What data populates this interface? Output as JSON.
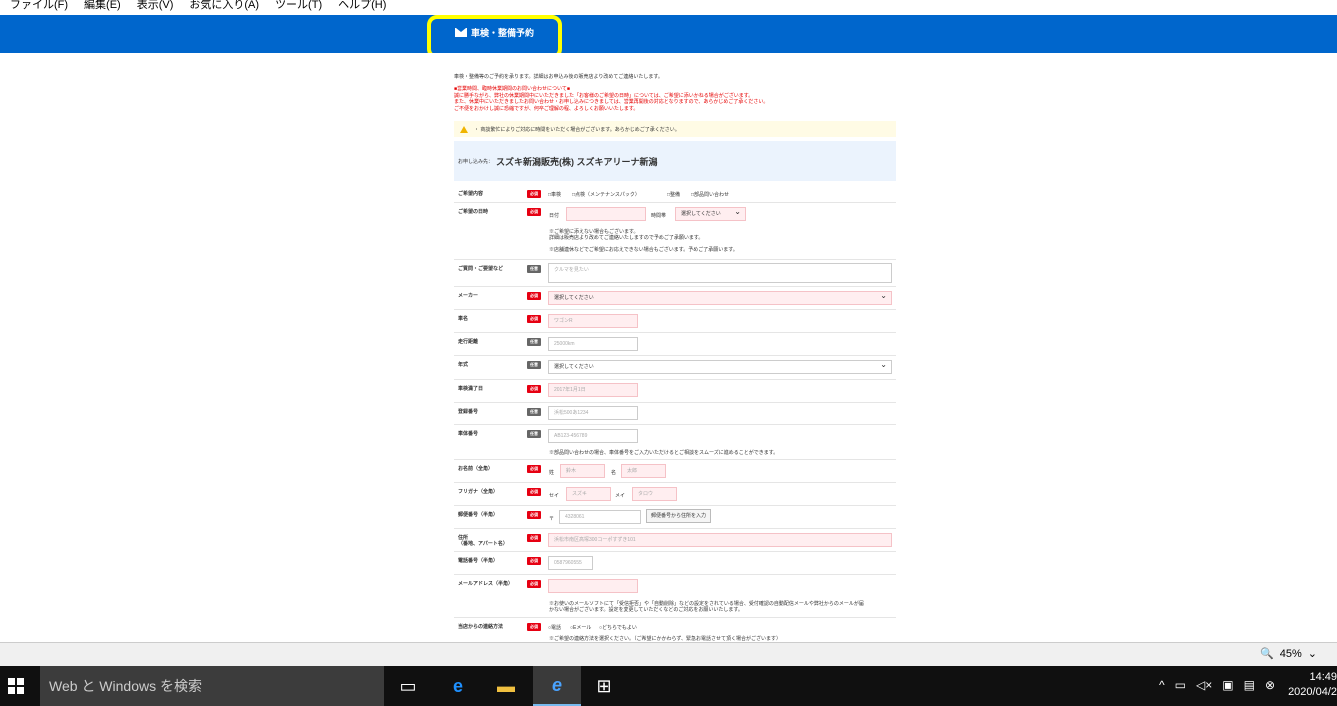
{
  "menu": [
    "ファイル(F)",
    "編集(E)",
    "表示(V)",
    "お気に入り(A)",
    "ツール(T)",
    "ヘルプ(H)"
  ],
  "header": {
    "title": "車検・整備予約"
  },
  "intro": "車検・整備等のご予約を承ります。詳細はお申込み後の販売店より改めてご連絡いたします。",
  "notice": [
    "■営業時間、臨時休業期間のお問い合わせについて■",
    "誠に勝手ながら、弊社の休業期間中にいただきました「お客様のご希望の日時」については、ご希望に添いかねる場合がございます。",
    "また、休業中にいただきましたお問い合わせ・お申し込みにつきましては、営業再開後の対応となりますので、あらかじめご了承ください。",
    "ご不便をおかけし誠に恐縮ですが、何卒ご理解の程、よろしくお願いいたします。"
  ],
  "warning": "・ 商談繁忙によりご対応に時間をいただく場合がございます。あらかじめご了承ください。",
  "store": {
    "prefix": "お申し込み先：",
    "name": "スズキ新潟販売(株) スズキアリーナ新潟"
  },
  "badges": {
    "required": "必須",
    "optional": "任意"
  },
  "form": {
    "content": {
      "label": "ご希望内容",
      "options": [
        "車検",
        "点検（メンテナンスパック）",
        "整備",
        "部品問い合わせ"
      ]
    },
    "datetime": {
      "label": "ご希望の日時",
      "date_label": "日付",
      "time_label": "時間帯",
      "time_value": "選択してください",
      "note1": "※ご希望に添えない場合もございます。",
      "note2": "詳細は販売店より改めてご連絡いたしますので予めご了承願います。",
      "note3": "※店舗連休などでご希望にお応えできない場合もございます。予めご了承願います。"
    },
    "question": {
      "label": "ご質問・ご要望など",
      "placeholder": "クルマを見たい"
    },
    "maker": {
      "label": "メーカー",
      "value": "選択してください"
    },
    "carname": {
      "label": "車名",
      "placeholder": "ワゴンR"
    },
    "mileage": {
      "label": "走行距離",
      "placeholder": "25000km"
    },
    "year": {
      "label": "年式",
      "value": "選択してください"
    },
    "inspection": {
      "label": "車検満了日",
      "placeholder": "2017年1月1日"
    },
    "plate": {
      "label": "登録番号",
      "placeholder": "浜松500あ1234"
    },
    "vin": {
      "label": "車体番号",
      "placeholder": "AB123-456789",
      "note": "※部品問い合わせの場合、車体番号をご入力いただけるとご相談をスムーズに進めることができます。"
    },
    "name": {
      "label": "お名前（全角）",
      "sei": "姓",
      "mei": "名",
      "sei_ph": "鈴木",
      "mei_ph": "太郎"
    },
    "kana": {
      "label": "フリガナ（全角）",
      "sei": "セイ",
      "mei": "メイ",
      "sei_ph": "スズキ",
      "mei_ph": "タロウ"
    },
    "zip": {
      "label": "郵便番号（半角）",
      "mark": "〒",
      "placeholder": "4328061",
      "button": "郵便番号から住所を入力"
    },
    "address": {
      "label": "住所",
      "label2": "（番地、アパート名）",
      "placeholder": "浜松市南区高塚300コーポすずき101"
    },
    "phone": {
      "label": "電話番号（半角）",
      "placeholder": "0587960555"
    },
    "email": {
      "label": "メールアドレス（半角）",
      "note1": "※お使いのメールソフトにて「受信拒否」や「自動削除」などの設定をされている場合、受付確認の自動配信メールや弊社からのメールが届",
      "note2": "かない場合がございます。設定を変更していただくなどのご対応をお願いいたします。"
    },
    "contact": {
      "label": "当店からの連絡方法",
      "options": [
        "電話",
        "Eメール",
        "どちらでもよい"
      ],
      "note": "※ご希望の連絡方法を選択ください。（ご希望にかかわらず、緊急お電話させて頂く場合がございます）"
    }
  },
  "statusbar": {
    "zoom": "45%"
  },
  "taskbar": {
    "search_placeholder": "Web と Windows を検索",
    "time": "14:49",
    "date": "2020/04/2"
  }
}
